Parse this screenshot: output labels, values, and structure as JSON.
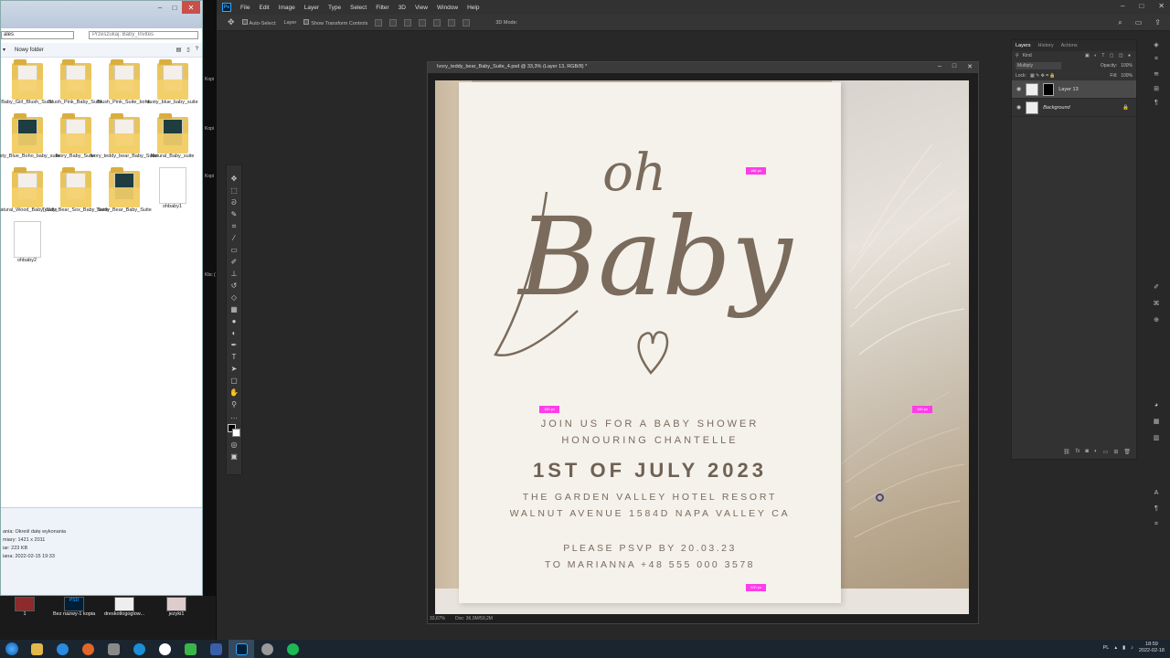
{
  "explorer": {
    "address": "ales",
    "search_placeholder": "Przeszukaj: Baby_Invites",
    "toolbar_item": "Nowy folder",
    "files": [
      {
        "name": "Baby_Girl_Blush_Suite",
        "kind": "folder",
        "paper": "light"
      },
      {
        "name": "Blush_Pink_Baby_Suite",
        "kind": "folder",
        "paper": "light"
      },
      {
        "name": "Blush_Pink_Suite_boho",
        "kind": "folder",
        "paper": "light"
      },
      {
        "name": "dusty_blue_baby_suite",
        "kind": "folder",
        "paper": "light"
      },
      {
        "name": "Dusty_Blue_Boho_baby_suite",
        "kind": "folder",
        "paper": "dark"
      },
      {
        "name": "Ivory_Baby_Suite",
        "kind": "folder",
        "paper": "light"
      },
      {
        "name": "Ivory_teddy_bear_Baby_Suite",
        "kind": "folder",
        "paper": "light"
      },
      {
        "name": "Natural_Baby_suite",
        "kind": "folder",
        "paper": "dark"
      },
      {
        "name": "Natural_Wood_Baby_Suite",
        "kind": "folder",
        "paper": "light"
      },
      {
        "name": "Teddy_Bear_Sox_Baby_Suite",
        "kind": "folder",
        "paper": "light"
      },
      {
        "name": "Teedy_Bear_Baby_Suite",
        "kind": "folder",
        "paper": "dark"
      },
      {
        "name": "ohbaby1",
        "kind": "image",
        "paper": "light"
      },
      {
        "name": "ohbaby2",
        "kind": "image",
        "paper": "light"
      }
    ],
    "details": {
      "line1": "ania: Określ datę wykonania",
      "line2": "miary: 1421 x 2011",
      "line3": "iar: 223 KB",
      "line4": "iana: 2022-02-15 19:33"
    }
  },
  "side_labels": [
    "Kopi",
    "Kopi",
    "Kopi",
    "Kbc ("
  ],
  "desktop": [
    {
      "label": "1"
    },
    {
      "label": "Bez nazwy-1 kopia"
    },
    {
      "label": "dreskotlogoglow..."
    },
    {
      "label": "jezyki1"
    }
  ],
  "photoshop": {
    "menu": [
      "File",
      "Edit",
      "Image",
      "Layer",
      "Type",
      "Select",
      "Filter",
      "3D",
      "View",
      "Window",
      "Help"
    ],
    "options": {
      "auto_select": "Auto-Select:",
      "auto_select_target": "Layer",
      "show_transform": "Show Transform Controls",
      "mode_3d": "3D Mode:"
    },
    "document": {
      "tab_title": "Ivory_teddy_bear_Baby_Suite_4.psd @ 33,3% (Layer 13, RGB/8) *",
      "zoom": "33,67%",
      "doc_size": "Doc: 36,0M/59,2M"
    },
    "card": {
      "script_top": "oh",
      "script_main": "Baby",
      "join": "JOIN US FOR A BABY SHOWER",
      "honouring": "HONOURING CHANTELLE",
      "date": "1ST OF JULY 2023",
      "venue": "THE GARDEN VALLEY  HOTEL  RESORT",
      "address": "WALNUT AVENUE 1584D NAPA VALLEY CA",
      "rsvp": "PLEASE PSVP BY 20.03.23",
      "contact": "TO MARIANNA +48 555 000 3578"
    },
    "measures": [
      "166 px",
      "180 px",
      "180 px",
      "200 px"
    ],
    "layers_panel": {
      "tabs": [
        "Layers",
        "History",
        "Actions"
      ],
      "filter": "Kind",
      "blend": "Multiply",
      "opacity_label": "Opacity:",
      "opacity": "100%",
      "lock_label": "Lock:",
      "fill_label": "Fill:",
      "fill": "100%",
      "layers": [
        {
          "name": "Layer 13",
          "selected": true
        },
        {
          "name": "Background",
          "selected": false
        }
      ]
    }
  },
  "taskbar": {
    "tray_lang": "PL",
    "time": "18:59",
    "date": "2022-02-18"
  },
  "colors": {
    "accent_ps": "#31a8ff",
    "card_bg": "#f5f2ec",
    "ink": "#7a6b5c",
    "measure": "#ff3ce8"
  }
}
